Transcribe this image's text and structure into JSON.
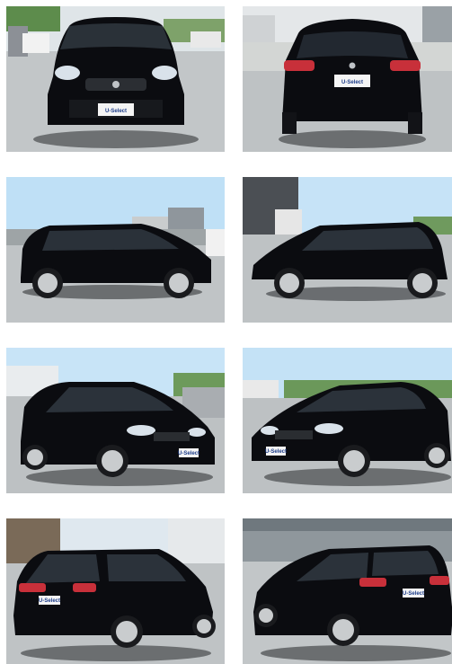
{
  "gallery": {
    "photos": [
      {
        "view": "front",
        "plate": "U-Select"
      },
      {
        "view": "rear",
        "plate": "U-Select"
      },
      {
        "view": "side-left",
        "plate": ""
      },
      {
        "view": "side-right",
        "plate": ""
      },
      {
        "view": "front-three-quarter-left",
        "plate": "U-Select"
      },
      {
        "view": "front-three-quarter-right",
        "plate": "U-Select"
      },
      {
        "view": "rear-three-quarter-left",
        "plate": "U-Select"
      },
      {
        "view": "rear-three-quarter-right",
        "plate": "U-Select"
      }
    ]
  },
  "colors": {
    "car_body": "#0b0c10",
    "sky": "#cfe6f7",
    "pavement": "#b9bdbf",
    "accent_taillight": "#c8303a"
  }
}
